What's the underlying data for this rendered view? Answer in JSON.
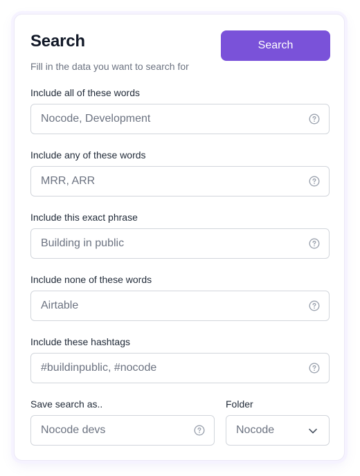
{
  "header": {
    "title": "Search",
    "subtitle": "Fill in the data you want to search for",
    "search_button": "Search"
  },
  "fields": [
    {
      "label": "Include all of these words",
      "value": "Nocode, Development",
      "icon": "help-circle-icon"
    },
    {
      "label": "Include any of these words",
      "value": "MRR, ARR",
      "icon": "help-circle-icon"
    },
    {
      "label": "Include this exact phrase",
      "value": "Building in public",
      "icon": "help-circle-icon"
    },
    {
      "label": "Include none of these words",
      "value": "Airtable",
      "icon": "help-circle-icon"
    },
    {
      "label": "Include these hashtags",
      "value": "#buildinpublic, #nocode",
      "icon": "help-circle-icon"
    }
  ],
  "save_search": {
    "label": "Save search as..",
    "value": "Nocode devs",
    "icon": "help-circle-icon"
  },
  "folder": {
    "label": "Folder",
    "selected": "Nocode",
    "icon": "chevron-down-icon"
  },
  "colors": {
    "accent": "#7a52d9",
    "border": "#d1d5db",
    "muted_text": "#6b7280"
  }
}
